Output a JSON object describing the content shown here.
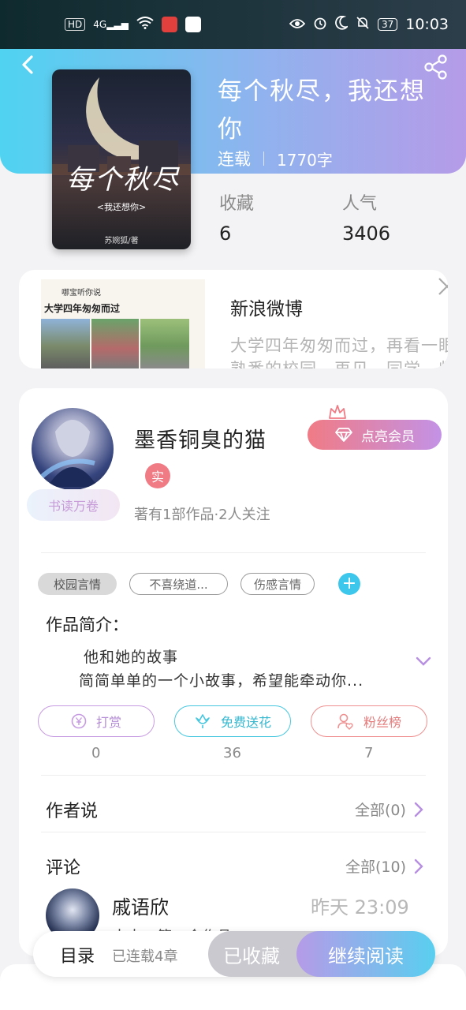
{
  "status_bar": {
    "network_badge": "HD",
    "signal": "4G",
    "time": "10:03",
    "battery": "37"
  },
  "book": {
    "title": "每个秋尽，我还想你",
    "status": "连载",
    "word_count": "1770字",
    "cover_title": "每个秋尽",
    "cover_subtitle": "<我还想你>",
    "cover_author": "苏婉狐/著",
    "stats": [
      {
        "label": "收藏",
        "value": "6"
      },
      {
        "label": "人气",
        "value": "3406"
      }
    ]
  },
  "ad": {
    "source": "新浪微博",
    "headline_in_thumb": "大学四年匆匆而过",
    "thumb_brand": "哪宝听你说",
    "desc": "大学四年匆匆而过，再看一眼",
    "desc_line2": "熟悉的校园，再见，同学，师"
  },
  "author": {
    "name": "墨香铜臭的猫",
    "real_badge": "实",
    "reader_badge": "书读万卷",
    "vip_button": "点亮会员",
    "stats_text": "著有1部作品·2人关注"
  },
  "tags": [
    "校园言情",
    "不喜绕道...",
    "伤感言情"
  ],
  "intro": {
    "label": "作品简介：",
    "line1": "他和她的故事",
    "line2": "简简单单的一个小故事，希望能牵动你..."
  },
  "actions": [
    {
      "label": "打赏",
      "count": "0",
      "color": "#c79be2"
    },
    {
      "label": "免费送花",
      "count": "36",
      "color": "#45c7df"
    },
    {
      "label": "粉丝榜",
      "count": "7",
      "color": "#ef8f8f"
    }
  ],
  "author_says": {
    "label": "作者说",
    "link": "全部(0)"
  },
  "comments": {
    "label": "评论",
    "link": "全部(10)",
    "first": {
      "user": "戚语欣",
      "time": "昨天 23:09",
      "text": "大大，第一个作品"
    }
  },
  "bottom_bar": {
    "toc": "目录",
    "chapters": "已连载4章",
    "collected": "已收藏",
    "continue": "继续阅读"
  },
  "colors": {
    "header_gradient_start": "#4fd3f0",
    "header_gradient_end": "#b59be8",
    "vip_pink": "#f07b85",
    "accent_blue": "#3ec7ec",
    "chevron_purple": "#b78fe0"
  }
}
